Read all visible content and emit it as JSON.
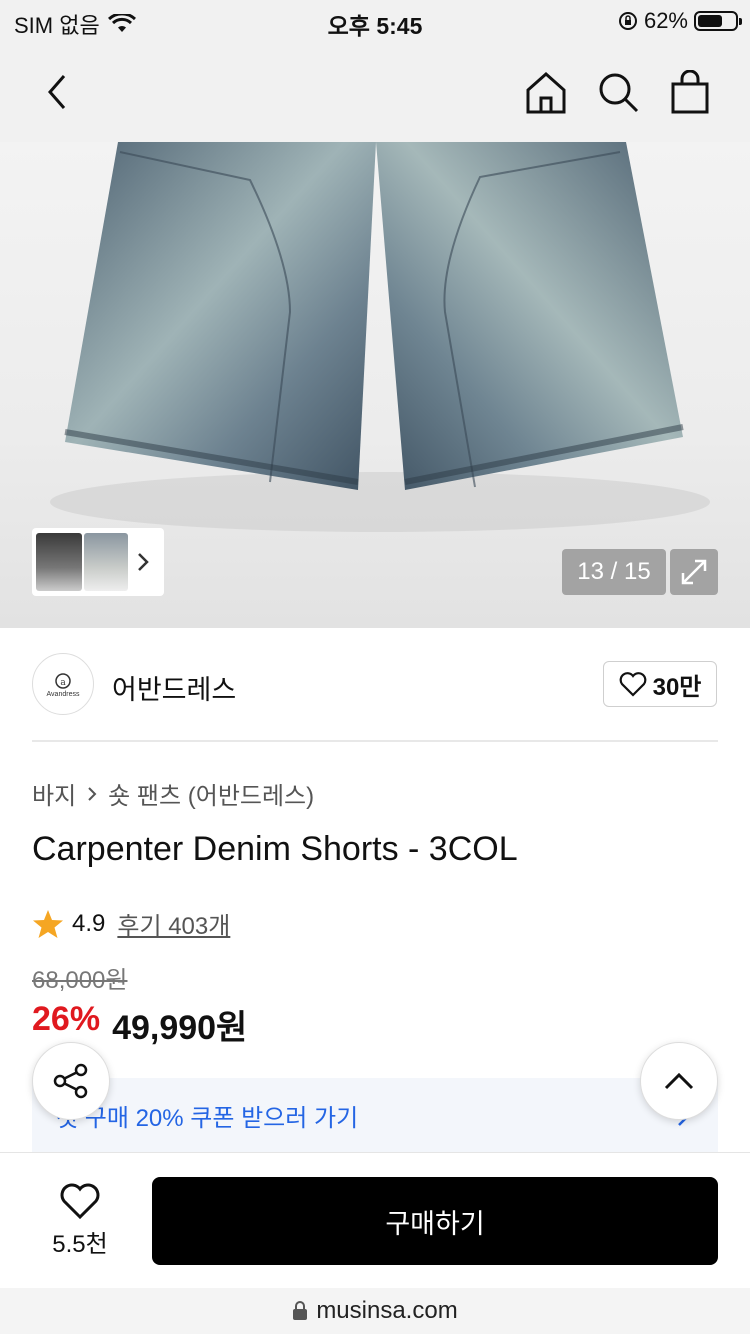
{
  "status_bar": {
    "carrier": "SIM 없음",
    "time": "오후 5:45",
    "battery_percent": "62%",
    "icons": [
      "wifi-icon",
      "orientation-lock-icon",
      "battery-icon"
    ]
  },
  "nav": {
    "icons": [
      "back-icon",
      "home-icon",
      "search-icon",
      "shopping-bag-icon"
    ]
  },
  "gallery": {
    "counter": "13 / 15",
    "current_index": 13,
    "total": 15
  },
  "brand": {
    "name": "어반드레스",
    "likes": "30만",
    "logo_text": "Avandress"
  },
  "breadcrumb": {
    "category": "바지",
    "subcategory": "숏 팬츠 (어반드레스)"
  },
  "product": {
    "title": "Carpenter Denim Shorts - 3COL",
    "rating": "4.9",
    "reviews": "후기 403개",
    "original_price": "68,000원",
    "discount": "26%",
    "sale_price": "49,990원"
  },
  "coupon": {
    "label": "첫 구매 20% 쿠폰 받으러 가기"
  },
  "bottom": {
    "wish_count": "5.5천",
    "buy_label": "구매하기"
  },
  "browser": {
    "url": "musinsa.com"
  },
  "colors": {
    "discount": "#e0191f",
    "coupon_text": "#2465e4",
    "buy_button": "#000000",
    "star": "#f5a623"
  }
}
